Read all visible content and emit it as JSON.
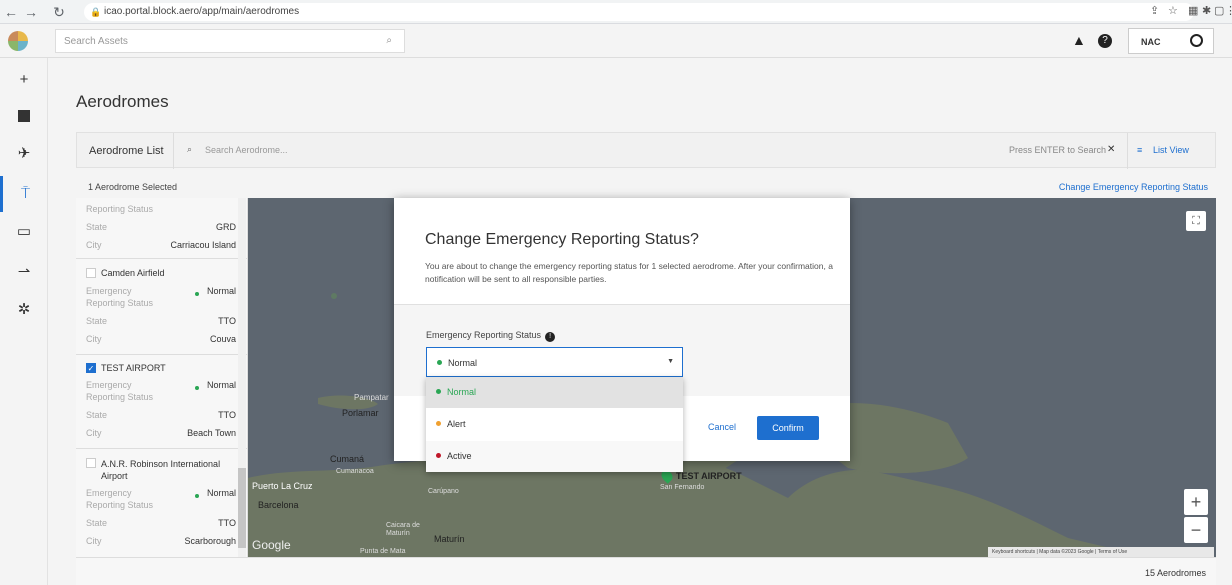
{
  "browser": {
    "url": "icao.portal.block.aero/app/main/aerodromes"
  },
  "topbar": {
    "search_placeholder": "Search Assets",
    "user_label": "NAC"
  },
  "page": {
    "title": "Aerodromes",
    "list_label": "Aerodrome List",
    "search_placeholder": "Search Aerodrome...",
    "press_enter": "Press ENTER to Search",
    "list_view": "List View",
    "selected_count": "1 Aerodrome Selected",
    "change_status_link": "Change Emergency Reporting Status",
    "total_count": "15 Aerodromes"
  },
  "labels": {
    "emergency": "Emergency",
    "reporting_status": "Reporting Status",
    "state": "State",
    "city": "City"
  },
  "aerodromes": [
    {
      "name": "",
      "status": "",
      "state": "GRD",
      "city": "Carriacou Island",
      "checked": false
    },
    {
      "name": "Camden Airfield",
      "status": "Normal",
      "state": "TTO",
      "city": "Couva",
      "checked": false
    },
    {
      "name": "TEST AIRPORT",
      "status": "Normal",
      "state": "TTO",
      "city": "Beach Town",
      "checked": true
    },
    {
      "name": "A.N.R. Robinson International Airport",
      "status": "Normal",
      "state": "TTO",
      "city": "Scarborough",
      "checked": false
    }
  ],
  "map": {
    "labels": [
      "Pampatar",
      "Porlamar",
      "Cumaná",
      "Cumanacoa",
      "Puerto La Cruz",
      "Barcelona",
      "Carúpano",
      "Caicara de Maturín",
      "Maturín",
      "Punta de Mata",
      "San Fernando",
      "TEST AIRPORT"
    ],
    "attribution": "Keyboard shortcuts | Map data ©2023 Google | Terms of Use",
    "google": "Google"
  },
  "modal": {
    "title": "Change Emergency Reporting Status?",
    "body": "You are about to change the emergency reporting status for 1 selected aerodrome. After your confirmation, a notification will be sent to all responsible parties.",
    "field_label": "Emergency Reporting Status",
    "selected_value": "Normal",
    "cancel": "Cancel",
    "confirm": "Confirm",
    "options": [
      {
        "label": "Normal",
        "color": "#2aa654"
      },
      {
        "label": "Alert",
        "color": "#f0a030"
      },
      {
        "label": "Active",
        "color": "#c0182a"
      }
    ]
  },
  "colors": {
    "accent": "#1e6fcf"
  }
}
